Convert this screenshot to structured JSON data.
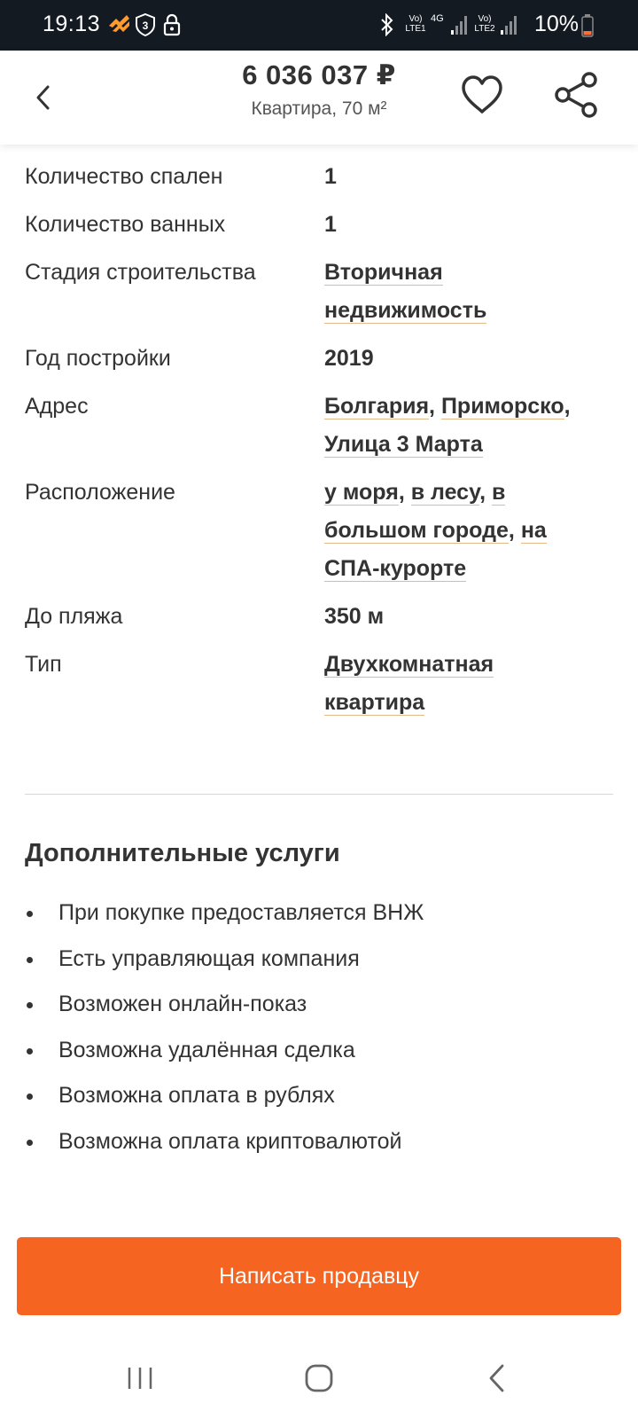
{
  "status_bar": {
    "time": "19:13",
    "notification_badge": "3",
    "network1": "Vo) LTE1",
    "network_type": "4G",
    "network2": "Vo) LTE2",
    "battery": "10%",
    "battery_color": "#ff6d3a"
  },
  "header": {
    "price": "6 036 037 ₽",
    "subtitle": "Квартира, 70 м²"
  },
  "params": [
    {
      "label": "Количество спален",
      "value": "1"
    },
    {
      "label": "Количество ванных",
      "value": "1"
    },
    {
      "label": "Стадия строительства",
      "links": [
        "Вторичная недвижимость"
      ]
    },
    {
      "label": "Год постройки",
      "value": "2019"
    },
    {
      "label": "Адрес",
      "links": [
        "Болгария",
        "Приморско",
        "Улица 3 Марта"
      ]
    },
    {
      "label": "Расположение",
      "links": [
        "у моря",
        "в лесу",
        "в большом городе",
        "на СПА-курорте"
      ]
    },
    {
      "label": "До пляжа",
      "value": "350 м"
    },
    {
      "label": "Тип",
      "links": [
        "Двухкомнатная квартира"
      ]
    }
  ],
  "services": {
    "title": "Дополнительные услуги",
    "items": [
      "При покупке предоставляется ВНЖ",
      "Есть управляющая компания",
      "Возможен онлайн-показ",
      "Возможна удалённая сделка",
      "Возможна оплата в рублях",
      "Возможна оплата криптовалютой"
    ]
  },
  "contact_button": "Написать продавцу",
  "colors": {
    "accent": "#f56420",
    "link_underline": "#e3b98a",
    "status_bar": "#141a22"
  },
  "icons": {
    "back": "chevron-left-icon",
    "favorite": "heart-icon",
    "share": "share-icon",
    "nav_recents": "recents-icon",
    "nav_home": "home-icon",
    "nav_back": "back-icon"
  }
}
